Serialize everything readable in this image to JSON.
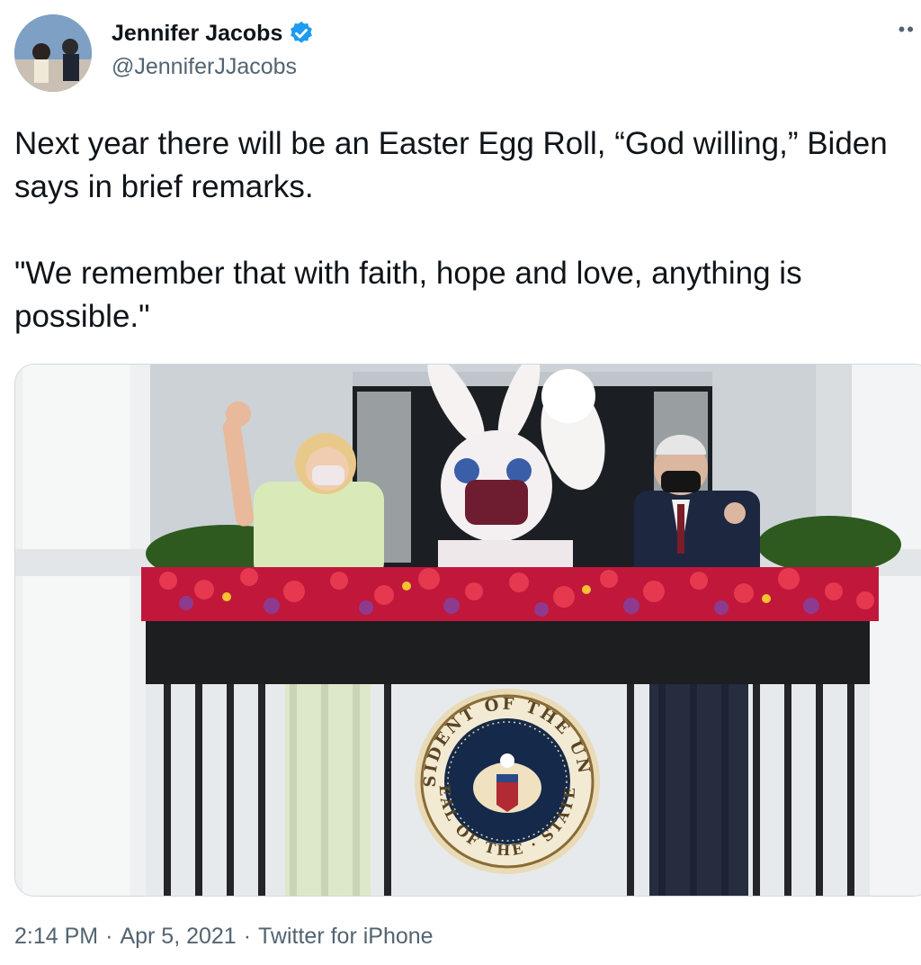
{
  "tweet": {
    "author_name": "Jennifer Jacobs",
    "author_handle": "@JenniferJJacobs",
    "verified_icon": "verified-badge-icon",
    "more_icon": "more-options-icon",
    "text": "Next year there will be an Easter Egg Roll, “God willing,” Biden says in brief remarks.\n\n\"We remember that with faith, hope and love, anything is possible.\"",
    "time": "2:14 PM",
    "date": "Apr 5, 2021",
    "source": "Twitter for iPhone"
  },
  "media": {
    "seal_top_text": "PRESIDENT OF THE UNITED",
    "seal_bottom_text": "SEAL OF THE · STATES"
  },
  "colors": {
    "verified_blue": "#1d9bf0",
    "secondary_text": "#536471",
    "primary_text": "#0f1419"
  }
}
